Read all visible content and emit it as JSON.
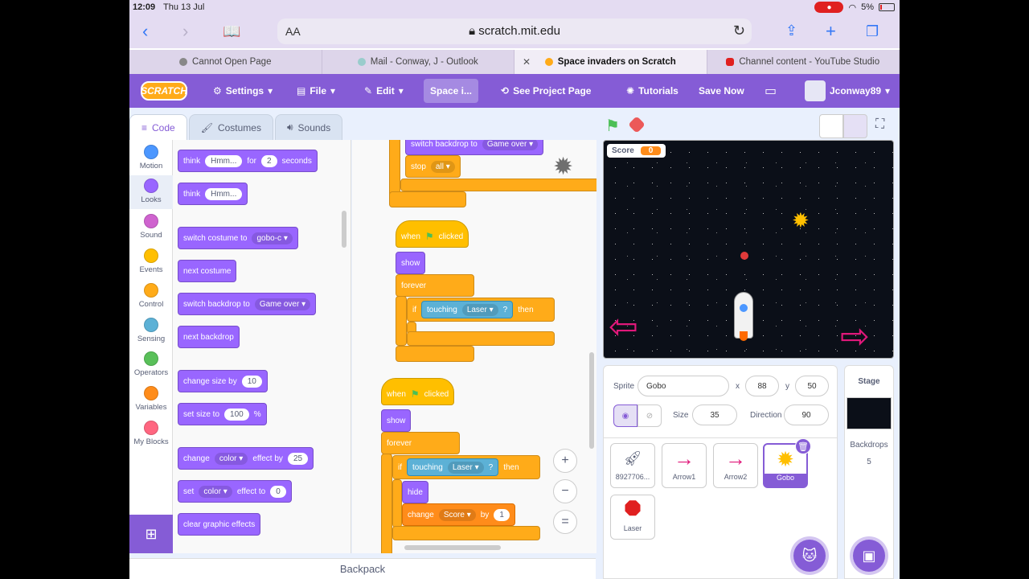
{
  "status": {
    "time": "12:09",
    "date": "Thu 13 Jul",
    "battery": "5%"
  },
  "browser": {
    "address_size_label": "AA",
    "url": "scratch.mit.edu",
    "tabs": [
      {
        "label": "Cannot Open Page"
      },
      {
        "label": "Mail - Conway, J - Outlook"
      },
      {
        "label": "Space invaders on Scratch"
      },
      {
        "label": "Channel content - YouTube Studio"
      }
    ]
  },
  "menu": {
    "logo": "SCRATCH",
    "settings": "Settings",
    "file": "File",
    "edit": "Edit",
    "project_title": "Space i...",
    "see_project": "See Project Page",
    "tutorials": "Tutorials",
    "save_now": "Save Now",
    "username": "Jconway89"
  },
  "editor_tabs": {
    "code": "Code",
    "costumes": "Costumes",
    "sounds": "Sounds"
  },
  "categories": [
    {
      "label": "Motion",
      "color": "#4c97ff"
    },
    {
      "label": "Looks",
      "color": "#9966ff"
    },
    {
      "label": "Sound",
      "color": "#cf63cf"
    },
    {
      "label": "Events",
      "color": "#ffbf00"
    },
    {
      "label": "Control",
      "color": "#ffab19"
    },
    {
      "label": "Sensing",
      "color": "#5cb1d6"
    },
    {
      "label": "Operators",
      "color": "#59c059"
    },
    {
      "label": "Variables",
      "color": "#ff8c1a"
    },
    {
      "label": "My Blocks",
      "color": "#ff6680"
    }
  ],
  "palette": {
    "think_for": {
      "word": "think",
      "msg": "Hmm...",
      "for": "for",
      "secs": "2",
      "seconds": "seconds"
    },
    "think": {
      "word": "think",
      "msg": "Hmm..."
    },
    "switch_costume": {
      "label": "switch costume to",
      "value": "gobo-c"
    },
    "next_costume": "next costume",
    "switch_backdrop": {
      "label": "switch backdrop to",
      "value": "Game over"
    },
    "next_backdrop": "next backdrop",
    "change_size": {
      "label": "change size by",
      "value": "10"
    },
    "set_size": {
      "label": "set size to",
      "value": "100",
      "unit": "%"
    },
    "change_effect": {
      "label": "change",
      "effect": "color",
      "by": "effect by",
      "value": "25"
    },
    "set_effect": {
      "label": "set",
      "effect": "color",
      "to": "effect to",
      "value": "0"
    },
    "clear_effects": "clear graphic effects"
  },
  "scripts": {
    "top": {
      "switch_backdrop": "switch backdrop to",
      "backdrop": "Game over",
      "stop": "stop",
      "stop_opt": "all"
    },
    "s1": {
      "when": "when",
      "clicked": "clicked",
      "show": "show",
      "forever": "forever",
      "if": "if",
      "touching": "touching",
      "target": "Laser",
      "q": "?",
      "then": "then"
    },
    "s2": {
      "when": "when",
      "clicked": "clicked",
      "show": "show",
      "forever": "forever",
      "if": "if",
      "touching": "touching",
      "target": "Laser",
      "q": "?",
      "then": "then",
      "hide": "hide",
      "change": "change",
      "var": "Score",
      "by": "by",
      "amount": "1"
    }
  },
  "zoom": {
    "in": "+",
    "out": "−",
    "reset": "="
  },
  "backpack": "Backpack",
  "stage": {
    "score_label": "Score",
    "score_value": "0"
  },
  "sprite_info": {
    "sprite_label": "Sprite",
    "sprite_name": "Gobo",
    "x_label": "x",
    "x": "88",
    "y_label": "y",
    "y": "50",
    "size_label": "Size",
    "size": "35",
    "direction_label": "Direction",
    "direction": "90"
  },
  "sprites": [
    {
      "name": "8927706...",
      "icon": "rocket-icon"
    },
    {
      "name": "Arrow1",
      "icon": "arrow-icon"
    },
    {
      "name": "Arrow2",
      "icon": "arrow-icon"
    },
    {
      "name": "Gobo",
      "icon": "gobo-icon",
      "selected": true
    },
    {
      "name": "Laser",
      "icon": "octagon-icon"
    }
  ],
  "stage_panel": {
    "title": "Stage",
    "backdrops_label": "Backdrops",
    "backdrops_count": "5"
  }
}
